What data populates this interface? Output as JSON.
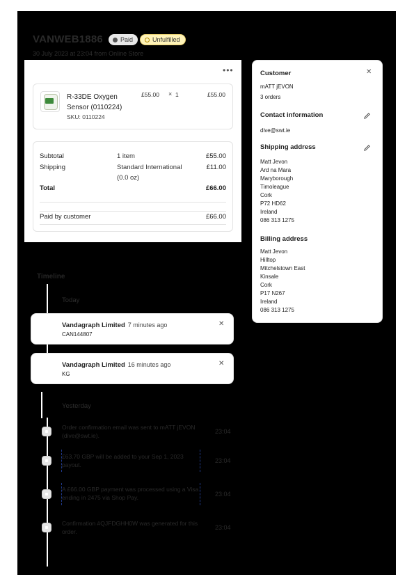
{
  "order": {
    "number": "VANWEB1886",
    "paid_badge": "Paid",
    "unfulfilled_badge": "Unfulfilled",
    "date": "30 July 2023 at 23:04",
    "from_text": "from Online Store"
  },
  "line_item": {
    "name": "R-33DE Oxygen Sensor (0110224)",
    "sku": "SKU: 0110224",
    "price": "£55.00",
    "times": "×",
    "qty": "1",
    "total": "£55.00"
  },
  "summary": {
    "subtotal_label": "Subtotal",
    "subtotal_items": "1 item",
    "subtotal_value": "£55.00",
    "shipping_label": "Shipping",
    "shipping_method": "Standard International",
    "shipping_weight": "(0.0 oz)",
    "shipping_value": "£11.00",
    "total_label": "Total",
    "total_value": "£66.00",
    "paid_label": "Paid by customer",
    "paid_value": "£66.00"
  },
  "customer": {
    "heading": "Customer",
    "name": "mATT jEVON",
    "orders": "3 orders",
    "contact_heading": "Contact information",
    "email": "dive@swt.ie",
    "shipping_heading": "Shipping address",
    "shipping_lines": [
      "Matt Jevon",
      "Ard na Mara",
      "Maryborough",
      "Timoleague",
      "Cork",
      "P72 HD62",
      "Ireland",
      "086 313 1275"
    ],
    "billing_heading": "Billing address",
    "billing_lines": [
      "Matt Jevon",
      "Hilltop",
      "Mitchelstown East",
      "Kinsale",
      "Cork",
      "P17 N267",
      "Ireland",
      "086 313 1275"
    ]
  },
  "timeline": {
    "heading": "Timeline",
    "today": "Today",
    "notes": [
      {
        "author": "Vandagraph Limited",
        "time": "7 minutes ago",
        "message": "CAN144807"
      },
      {
        "author": "Vandagraph Limited",
        "time": "16 minutes ago",
        "message": "KG"
      }
    ],
    "yesterday": "Yesterday",
    "events": [
      {
        "text": "Order confirmation email was sent to mATT jEVON (dive@swt.ie).",
        "time": "23:04"
      },
      {
        "text": "£63.70 GBP will be added to your Sep 1, 2023 payout.",
        "time": "23:04"
      },
      {
        "text": "A £66.00 GBP payment was processed using a Visa ending in 2475 via Shop Pay.",
        "time": "23:04"
      },
      {
        "text": "Confirmation #QJFDGHH0W was generated for this order.",
        "time": "23:04"
      }
    ]
  }
}
